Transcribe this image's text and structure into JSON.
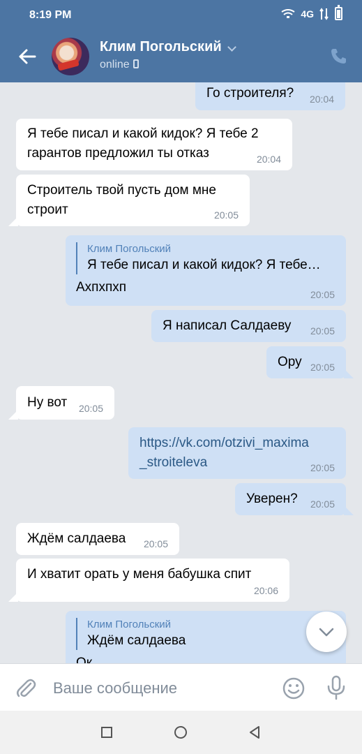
{
  "status_bar": {
    "time": "8:19 PM",
    "network": "4G"
  },
  "header": {
    "contact_name": "Клим Погольский",
    "presence": "online"
  },
  "messages": [
    {
      "text": "Го строителя?",
      "time": "20:04"
    },
    {
      "text_line1": "Я тебе писал и какой кидок? Я тебе 2",
      "text_line2": "гарантов предложил ты отказ",
      "time": "20:04"
    },
    {
      "text_line1": "Строитель твой пусть дом мне",
      "text_line2": "строит",
      "time": "20:05"
    },
    {
      "reply_author": "Клим Погольский",
      "reply_text": "Я тебе писал и какой кидок? Я тебе…",
      "text": "Ахпхпхп",
      "time": "20:05"
    },
    {
      "text": "Я написал Салдаеву",
      "time": "20:05"
    },
    {
      "text": "Ору",
      "time": "20:05"
    },
    {
      "text": "Ну вот",
      "time": "20:05"
    },
    {
      "link_line1": "https://vk.com/otzivi_maxima",
      "link_line2": "_stroiteleva",
      "time": "20:05"
    },
    {
      "text": "Уверен?",
      "time": "20:05"
    },
    {
      "text": "Ждём салдаева",
      "time": "20:05"
    },
    {
      "text": "И хватит орать у меня бабушка спит",
      "time": "20:06"
    },
    {
      "reply_author": "Клим Погольский",
      "reply_text": "Ждём салдаева",
      "text": "Ок"
    }
  ],
  "composer": {
    "placeholder": "Ваше сообщение"
  },
  "icons": {
    "back": "arrow-left-icon",
    "call": "phone-icon",
    "attach": "paperclip-icon",
    "emoji": "smile-icon",
    "mic": "microphone-icon",
    "scroll": "chevron-down-icon"
  },
  "colors": {
    "header": "#4c75a3",
    "outgoing": "#cfe0f5",
    "incoming": "#ffffff",
    "background": "#e4e7eb",
    "accent": "#5181b8"
  }
}
